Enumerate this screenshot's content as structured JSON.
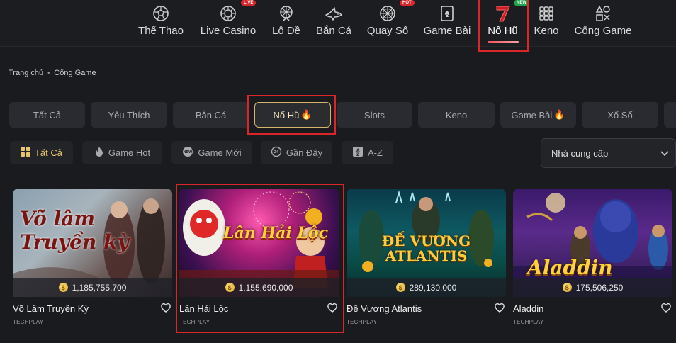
{
  "nav": {
    "items": [
      {
        "label": "Thể Thao",
        "icon": "soccer-ball-icon",
        "badge": ""
      },
      {
        "label": "Live Casino",
        "icon": "casino-chip-icon",
        "badge": "LIVE"
      },
      {
        "label": "Lô Đề",
        "icon": "lottery-wheel-icon",
        "badge": ""
      },
      {
        "label": "Bắn Cá",
        "icon": "shark-icon",
        "badge": ""
      },
      {
        "label": "Quay Số",
        "icon": "spin-wheel-icon",
        "badge": "HOT"
      },
      {
        "label": "Game Bài",
        "icon": "playing-card-icon",
        "badge": ""
      },
      {
        "label": "Nổ Hũ",
        "icon": "lucky-seven-icon",
        "badge": "NEW",
        "active": true
      },
      {
        "label": "Keno",
        "icon": "keno-grid-icon",
        "badge": ""
      },
      {
        "label": "Cổng Game",
        "icon": "gamepad-shapes-icon",
        "badge": ""
      }
    ]
  },
  "breadcrumb": {
    "home": "Trang chủ",
    "current": "Cổng Game"
  },
  "categories": [
    {
      "label": "Tất Cả"
    },
    {
      "label": "Yêu Thích"
    },
    {
      "label": "Bắn Cá"
    },
    {
      "label": "Nổ Hũ",
      "active": true,
      "fire": true
    },
    {
      "label": "Slots"
    },
    {
      "label": "Keno"
    },
    {
      "label": "Game Bài",
      "fire": true
    },
    {
      "label": "Xổ Số"
    }
  ],
  "filters": [
    {
      "label": "Tất Cả",
      "icon": "grid-icon",
      "active": true
    },
    {
      "label": "Game Hot",
      "icon": "flame-icon"
    },
    {
      "label": "Game Mới",
      "icon": "new-badge-icon"
    },
    {
      "label": "Gần Đây",
      "icon": "recent-clock-icon"
    },
    {
      "label": "A-Z",
      "icon": "sort-az-icon"
    }
  ],
  "provider": {
    "label": "Nhà cung cấp"
  },
  "games": [
    {
      "title": "Võ Lâm Truyền Kỳ",
      "jackpot": "1,185,755,700",
      "provider": "TECHPLAY",
      "art_text": "Võ lâm Truyền kỳ"
    },
    {
      "title": "Lân Hải Lộc",
      "jackpot": "1,155,690,000",
      "provider": "TECHPLAY",
      "art_text": "Lân Hải Lộc"
    },
    {
      "title": "Đế Vương Atlantis",
      "jackpot": "289,130,000",
      "provider": "TECHPLAY",
      "art_text": "ĐẾ VƯƠNG ATLANTIS"
    },
    {
      "title": "Aladdin",
      "jackpot": "175,506,250",
      "provider": "TECHPLAY",
      "art_text": "Aladdin"
    }
  ],
  "colors": {
    "accent_gold": "#d6b469",
    "highlight_red": "#d8262a",
    "background": "#1a1b1e"
  }
}
